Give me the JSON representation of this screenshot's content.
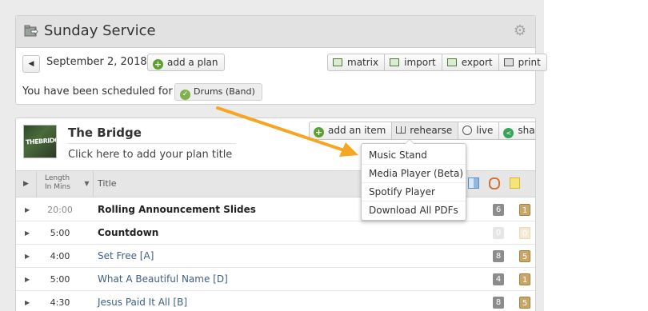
{
  "service": {
    "title": "Sunday Service"
  },
  "plan_nav": {
    "date": "September 2, 2018",
    "add_plan_label": "add a plan",
    "tools": [
      "matrix",
      "import",
      "export",
      "print"
    ]
  },
  "schedule": {
    "prefix": "You have been scheduled for",
    "role": "Drums (Band)"
  },
  "plan": {
    "series_title": "The Bridge",
    "thumb_text": "THEBRIDGE",
    "title_placeholder": "Click here to add your plan title",
    "actions": [
      "add an item",
      "rehearse",
      "live",
      "share"
    ]
  },
  "table": {
    "col_length": "Length In Mins",
    "col_length_line1": "Length",
    "col_length_line2": "In Mins",
    "col_title": "Title",
    "rows": [
      {
        "length": "20:00",
        "title": "Rolling Announcement Slides",
        "attachments": "6",
        "notes": "1"
      },
      {
        "length": "5:00",
        "title": "Countdown",
        "attachments": "0",
        "notes": "0"
      },
      {
        "length": "4:00",
        "title": "Set Free [A]",
        "attachments": "8",
        "notes": "5"
      },
      {
        "length": "5:00",
        "title": "What A Beautiful Name [D]",
        "attachments": "4",
        "notes": "1"
      },
      {
        "length": "4:30",
        "title": "Jesus Paid It All [B]",
        "attachments": "8",
        "notes": "5"
      }
    ]
  },
  "rehearse_menu": {
    "items": [
      "Music Stand",
      "Media Player (Beta)",
      "Spotify Player",
      "Download All PDFs"
    ]
  },
  "colors": {
    "arrow": "#f5a623",
    "link": "#3d5f87",
    "green": "#5aa22c"
  }
}
